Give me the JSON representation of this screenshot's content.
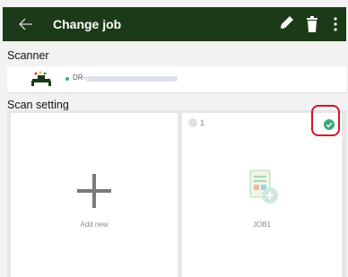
{
  "appbar": {
    "title": "Change job",
    "icons": [
      "back-arrow-icon",
      "pencil-icon",
      "trash-icon",
      "more-vertical-icon"
    ],
    "bg_color": "#1b3a17"
  },
  "scanner": {
    "section_label": "Scanner",
    "name": "DR-",
    "status_color": "#35b36b"
  },
  "scan_setting": {
    "section_label": "Scan setting",
    "add_card": {
      "label": "Add new",
      "icon": "plus-icon"
    },
    "job_card": {
      "number": "1",
      "label": "JOB1",
      "selected": true,
      "check_color": "#3daa7e",
      "highlight_color": "#d6122b"
    }
  }
}
